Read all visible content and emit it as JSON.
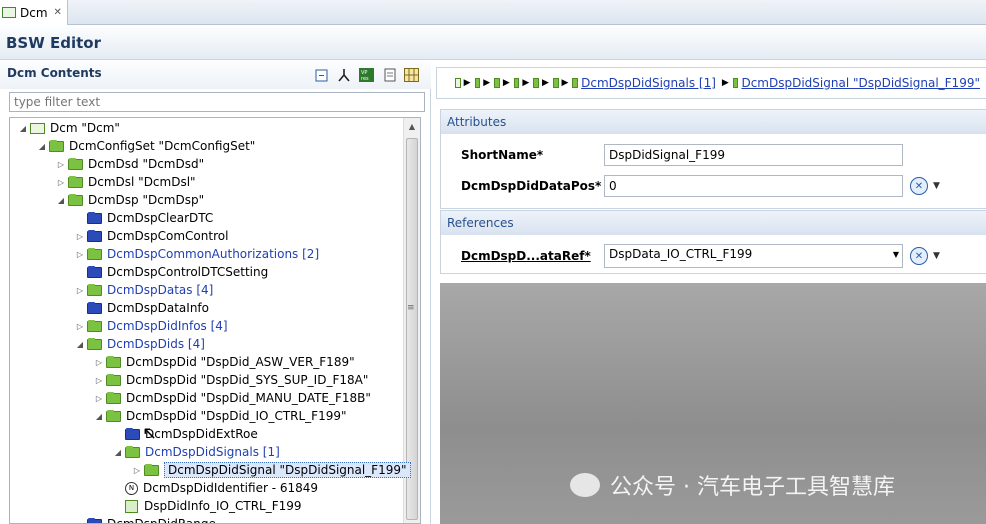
{
  "tab": {
    "label": "Dcm",
    "close": "✕"
  },
  "editor": {
    "title": "BSW Editor"
  },
  "left": {
    "title": "Dcm Contents",
    "filter_placeholder": "type filter text",
    "toolbar": [
      "collapse-all-icon",
      "fork-icon",
      "vp-res-icon",
      "document-icon",
      "grid-icon"
    ],
    "tree": [
      {
        "label": "Dcm \"Dcm\"",
        "indent": 0,
        "arrow": "open",
        "icon": "box",
        "link": false
      },
      {
        "label": "DcmConfigSet \"DcmConfigSet\"",
        "indent": 1,
        "arrow": "open",
        "icon": "green",
        "link": false
      },
      {
        "label": "DcmDsd \"DcmDsd\"",
        "indent": 2,
        "arrow": "closed",
        "icon": "green",
        "link": false
      },
      {
        "label": "DcmDsl \"DcmDsl\"",
        "indent": 2,
        "arrow": "closed",
        "icon": "green",
        "link": false
      },
      {
        "label": "DcmDsp \"DcmDsp\"",
        "indent": 2,
        "arrow": "open",
        "icon": "green",
        "link": false
      },
      {
        "label": "DcmDspClearDTC",
        "indent": 3,
        "arrow": "none",
        "icon": "blue",
        "link": false
      },
      {
        "label": "DcmDspComControl",
        "indent": 3,
        "arrow": "closed",
        "icon": "blue",
        "link": false
      },
      {
        "label": "DcmDspCommonAuthorizations [2]",
        "indent": 3,
        "arrow": "closed",
        "icon": "green",
        "link": true
      },
      {
        "label": "DcmDspControlDTCSetting",
        "indent": 3,
        "arrow": "none",
        "icon": "blue",
        "link": false
      },
      {
        "label": "DcmDspDatas [4]",
        "indent": 3,
        "arrow": "closed",
        "icon": "green",
        "link": true
      },
      {
        "label": "DcmDspDataInfo",
        "indent": 3,
        "arrow": "none",
        "icon": "blue",
        "link": false
      },
      {
        "label": "DcmDspDidInfos [4]",
        "indent": 3,
        "arrow": "closed",
        "icon": "green",
        "link": true
      },
      {
        "label": "DcmDspDids [4]",
        "indent": 3,
        "arrow": "open",
        "icon": "green",
        "link": true
      },
      {
        "label": "DcmDspDid \"DspDid_ASW_VER_F189\"",
        "indent": 4,
        "arrow": "closed",
        "icon": "green",
        "link": false
      },
      {
        "label": "DcmDspDid \"DspDid_SYS_SUP_ID_F18A\"",
        "indent": 4,
        "arrow": "closed",
        "icon": "green",
        "link": false
      },
      {
        "label": "DcmDspDid \"DspDid_MANU_DATE_F18B\"",
        "indent": 4,
        "arrow": "closed",
        "icon": "green",
        "link": false
      },
      {
        "label": "DcmDspDid \"DspDid_IO_CTRL_F199\"",
        "indent": 4,
        "arrow": "open",
        "icon": "green",
        "link": false
      },
      {
        "label": "DcmDspDidExtRoe",
        "indent": 5,
        "arrow": "none",
        "icon": "blue",
        "link": false
      },
      {
        "label": "DcmDspDidSignals [1]",
        "indent": 5,
        "arrow": "open",
        "icon": "green",
        "link": true
      },
      {
        "label": "DcmDspDidSignal \"DspDidSignal_F199\"",
        "indent": 6,
        "arrow": "closed",
        "icon": "green",
        "link": false,
        "selected": true
      },
      {
        "label": "DcmDspDidIdentifier - 61849",
        "indent": 5,
        "arrow": "none",
        "icon": "circle",
        "link": false
      },
      {
        "label": "DspDidInfo_IO_CTRL_F199",
        "indent": 5,
        "arrow": "none",
        "icon": "doc",
        "link": false
      },
      {
        "label": "DcmDspDidRange",
        "indent": 3,
        "arrow": "none",
        "icon": "blue",
        "link": false
      }
    ]
  },
  "right": {
    "breadcrumb": {
      "links": [
        "DcmDspDidSignals [1]",
        "DcmDspDidSignal \"DspDidSignal_F199\""
      ]
    },
    "attributes": {
      "header": "Attributes",
      "short_name_label": "ShortName*",
      "short_name_value": "DspDidSignal_F199",
      "data_pos_label": "DcmDspDidDataPos*",
      "data_pos_value": "0"
    },
    "references": {
      "header": "References",
      "data_ref_label": "DcmDspD...ataRef*",
      "data_ref_value": "DspData_IO_CTRL_F199"
    },
    "watermark": "公众号 · 汽车电子工具智慧库"
  }
}
